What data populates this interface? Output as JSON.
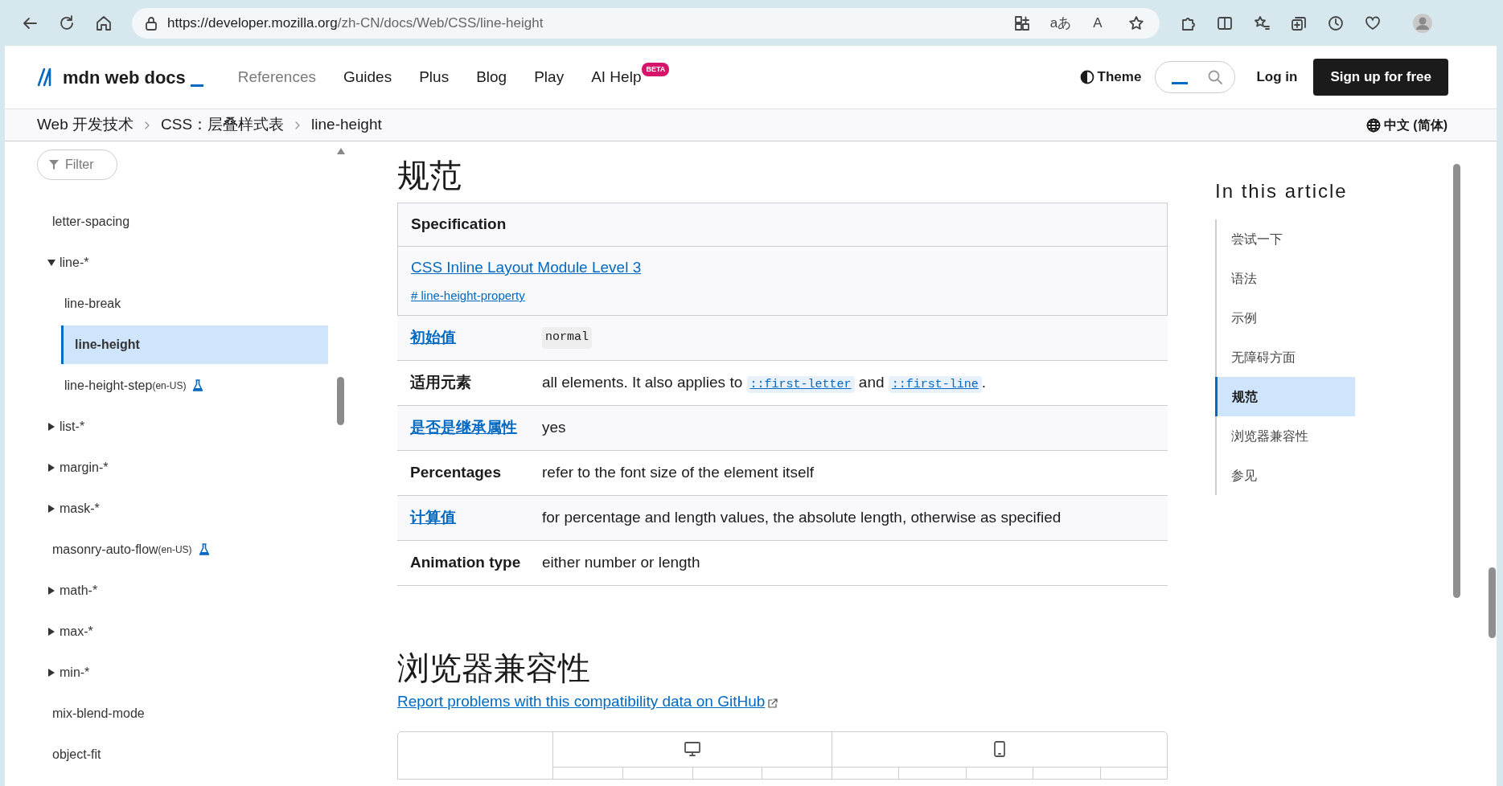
{
  "browser": {
    "url_host": "https://developer.mozilla.org",
    "url_path": "/zh-CN/docs/Web/CSS/line-height",
    "translate_label": "aあ",
    "read_aloud_label": "A"
  },
  "header": {
    "logo": "mdn web docs",
    "nav": [
      {
        "label": "References",
        "dimmed": true
      },
      {
        "label": "Guides",
        "dimmed": false
      },
      {
        "label": "Plus",
        "dimmed": false
      },
      {
        "label": "Blog",
        "dimmed": false
      },
      {
        "label": "Play",
        "dimmed": false
      },
      {
        "label": "AI Help",
        "dimmed": false,
        "badge": "BETA"
      }
    ],
    "theme": "Theme",
    "login": "Log in",
    "signup": "Sign up for free"
  },
  "breadcrumb": [
    "Web 开发技术",
    "CSS：层叠样式表",
    "line-height"
  ],
  "language": "中文 (简体)",
  "sidebar": {
    "filter_placeholder": "Filter",
    "items": [
      {
        "kind": "leaf",
        "label": "letter-spacing",
        "selected": false
      },
      {
        "kind": "group",
        "label": "line-*",
        "expanded": true,
        "children": [
          {
            "kind": "leaf",
            "label": "line-break",
            "selected": false
          },
          {
            "kind": "leaf",
            "label": "line-height",
            "selected": true
          },
          {
            "kind": "leaf",
            "label": "line-height-step",
            "note": "(en-US)",
            "experimental": true,
            "selected": false
          }
        ]
      },
      {
        "kind": "group",
        "label": "list-*",
        "expanded": false
      },
      {
        "kind": "group",
        "label": "margin-*",
        "expanded": false
      },
      {
        "kind": "group",
        "label": "mask-*",
        "expanded": false
      },
      {
        "kind": "leaf",
        "label": "masonry-auto-flow",
        "note": "(en-US)",
        "experimental": true,
        "selected": false
      },
      {
        "kind": "group",
        "label": "math-*",
        "expanded": false
      },
      {
        "kind": "group",
        "label": "max-*",
        "expanded": false
      },
      {
        "kind": "group",
        "label": "min-*",
        "expanded": false
      },
      {
        "kind": "leaf",
        "label": "mix-blend-mode",
        "selected": false
      },
      {
        "kind": "leaf",
        "label": "object-fit",
        "selected": false
      }
    ]
  },
  "article": {
    "heading": "规范",
    "spec_table": {
      "header": "Specification",
      "link": "CSS Inline Layout Module Level 3",
      "anchor": "# line-height-property"
    },
    "properties": [
      {
        "name": "初始值",
        "is_link": true,
        "value": [
          {
            "kind": "code",
            "text": "normal"
          }
        ]
      },
      {
        "name": "适用元素",
        "is_link": false,
        "value": [
          {
            "kind": "text",
            "text": "all elements. It also applies to "
          },
          {
            "kind": "code_link",
            "text": "::first-letter"
          },
          {
            "kind": "text",
            "text": " and "
          },
          {
            "kind": "code_link",
            "text": "::first-line"
          },
          {
            "kind": "text",
            "text": "."
          }
        ]
      },
      {
        "name": "是否是继承属性",
        "is_link": true,
        "value": [
          {
            "kind": "text",
            "text": "yes"
          }
        ]
      },
      {
        "name": "Percentages",
        "is_link": false,
        "value": [
          {
            "kind": "text",
            "text": "refer to the font size of the element itself"
          }
        ]
      },
      {
        "name": "计算值",
        "is_link": true,
        "value": [
          {
            "kind": "text",
            "text": "for percentage and length values, the absolute length, otherwise as specified"
          }
        ]
      },
      {
        "name": "Animation type",
        "is_link": false,
        "value": [
          {
            "kind": "text",
            "text": "either number or length"
          }
        ]
      }
    ],
    "compat_heading": "浏览器兼容性",
    "compat_link": "Report problems with this compatibility data on GitHub"
  },
  "toc": {
    "title": "In this article",
    "items": [
      {
        "label": "尝试一下",
        "selected": false
      },
      {
        "label": "语法",
        "selected": false
      },
      {
        "label": "示例",
        "selected": false
      },
      {
        "label": "无障碍方面",
        "selected": false
      },
      {
        "label": "规范",
        "selected": true
      },
      {
        "label": "浏览器兼容性",
        "selected": false
      },
      {
        "label": "参见",
        "selected": false
      }
    ]
  }
}
